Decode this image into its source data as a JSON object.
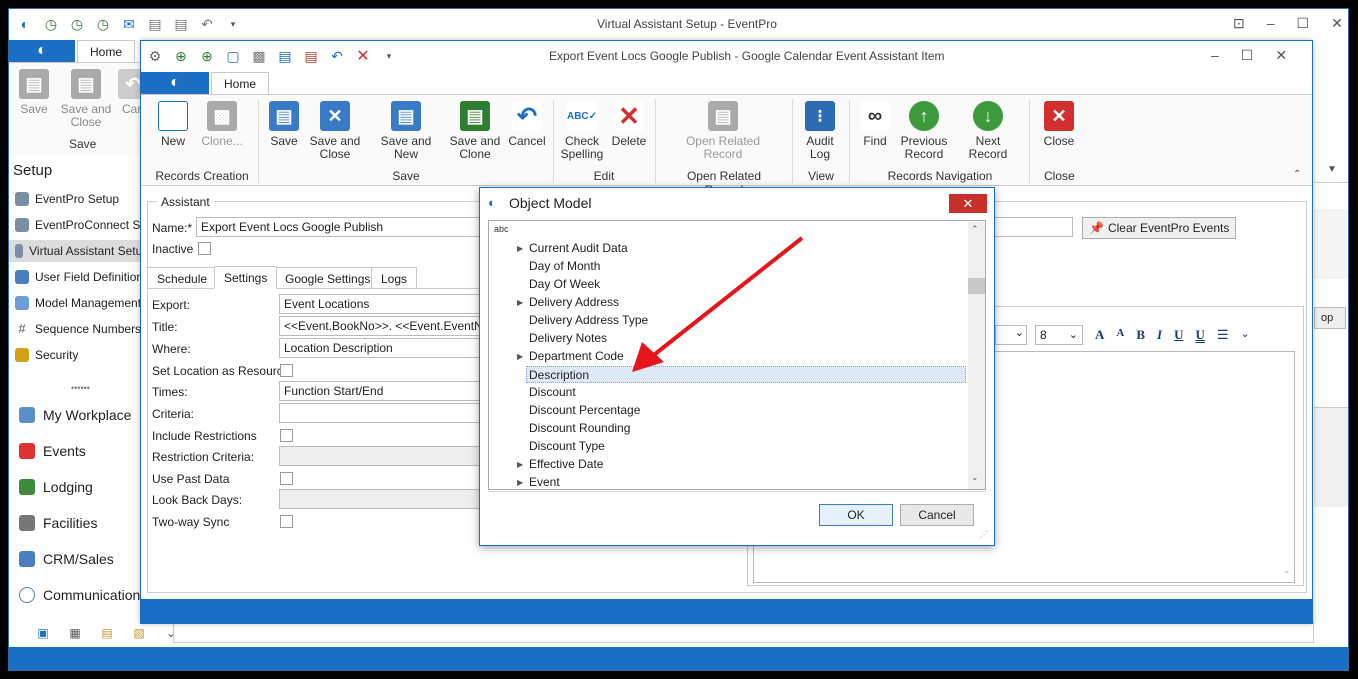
{
  "outer": {
    "title": "Virtual Assistant Setup - EventPro",
    "tab_home": "Home",
    "ribbon": {
      "save": "Save",
      "save_close": "Save and Close",
      "cancel": "Can",
      "group": "Save"
    },
    "setup_title": "Setup",
    "setup_items": [
      "EventPro Setup",
      "EventProConnect Setu",
      "Virtual Assistant Setup",
      "User Field Definition",
      "Model Management",
      "Sequence Numbers",
      "Security"
    ],
    "splitter": "••••••",
    "nav_items": [
      "My Workplace",
      "Events",
      "Lodging",
      "Facilities",
      "CRM/Sales",
      "Communications"
    ]
  },
  "inner": {
    "title": "Export Event Locs Google Publish - Google Calendar Event Assistant Item",
    "tab_home": "Home",
    "ribbon": {
      "new": "New",
      "clone": "Clone...",
      "group_records": "Records Creation",
      "save": "Save",
      "save_close": "Save and Close",
      "save_new": "Save and New",
      "save_clone": "Save and Clone",
      "cancel": "Cancel",
      "group_save": "Save",
      "check_spelling": "Check Spelling",
      "delete": "Delete",
      "group_edit": "Edit",
      "open_related": "Open Related Record",
      "group_open_related": "Open Related Record",
      "audit_log": "Audit Log",
      "group_view": "View",
      "find": "Find",
      "previous": "Previous Record",
      "next": "Next Record",
      "group_nav": "Records Navigation",
      "close": "Close",
      "group_close": "Close"
    },
    "assistant_label": "Assistant",
    "name_label": "Name:*",
    "name_value": "Export Event Locs Google Publish",
    "inactive_label": "Inactive",
    "clear_events": "Clear EventPro Events",
    "tabs": [
      "Schedule",
      "Settings",
      "Google Settings",
      "Logs"
    ],
    "form": {
      "export_label": "Export:",
      "export_value": "Event Locations",
      "title_label": "Title:",
      "title_value": "<<Event.BookNo>>. <<Event.EventNa",
      "where_label": "Where:",
      "where_value": "Location Description",
      "set_loc_label": "Set Location as Resource",
      "times_label": "Times:",
      "times_value": "Function Start/End",
      "criteria_label": "Criteria:",
      "include_restr_label": "Include Restrictions",
      "restr_criteria_label": "Restriction Criteria:",
      "use_past_label": "Use Past Data",
      "look_back_label": "Look Back Days:",
      "two_way_label": "Two-way Sync"
    },
    "font_size": "8",
    "side_btn": "op"
  },
  "dialog": {
    "title": "Object Model",
    "search_hint": "abc",
    "items": [
      {
        "label": "Current Audit Data",
        "expandable": true
      },
      {
        "label": "Day of Month",
        "expandable": false
      },
      {
        "label": "Day Of Week",
        "expandable": false
      },
      {
        "label": "Delivery Address",
        "expandable": true
      },
      {
        "label": "Delivery Address Type",
        "expandable": false
      },
      {
        "label": "Delivery Notes",
        "expandable": false
      },
      {
        "label": "Department Code",
        "expandable": true
      },
      {
        "label": "Description",
        "expandable": false,
        "selected": true
      },
      {
        "label": "Discount",
        "expandable": false
      },
      {
        "label": "Discount Percentage",
        "expandable": false
      },
      {
        "label": "Discount Rounding",
        "expandable": false
      },
      {
        "label": "Discount Type",
        "expandable": false
      },
      {
        "label": "Effective Date",
        "expandable": true
      },
      {
        "label": "Event",
        "expandable": true
      }
    ],
    "ok": "OK",
    "cancel": "Cancel"
  },
  "colors": {
    "accent": "#1a6fc4",
    "arrow": "#e8141c",
    "close_red": "#e81123"
  }
}
